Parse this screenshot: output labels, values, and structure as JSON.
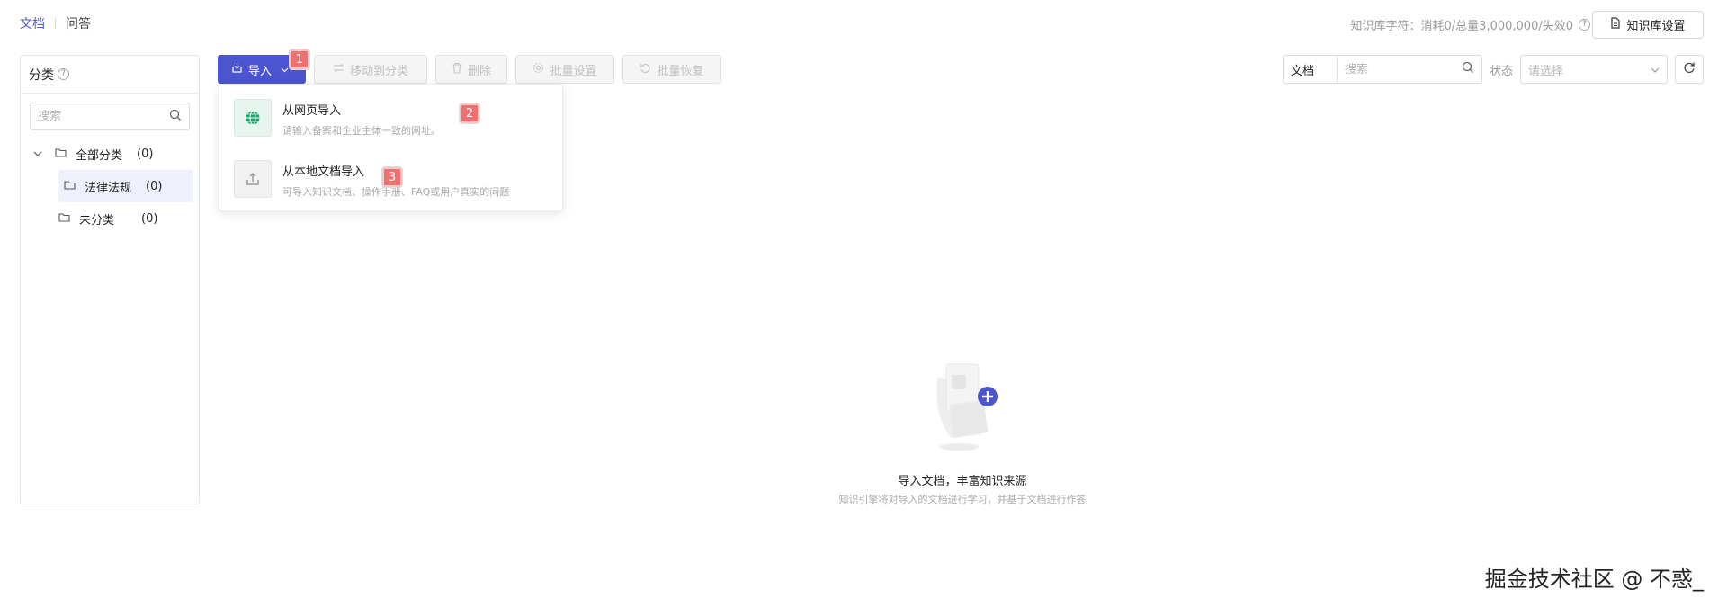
{
  "top_tabs": {
    "docs": "文档",
    "qa": "问答"
  },
  "quota": {
    "text": "知识库字符：消耗0/总量3,000,000/失效0",
    "help": "?"
  },
  "kb_settings_label": "知识库设置",
  "sidebar": {
    "title": "分类",
    "search_placeholder": "搜索",
    "tree": [
      {
        "label": "全部分类",
        "count": "(0)"
      },
      {
        "label": "法律法规",
        "count": "(0)"
      },
      {
        "label": "未分类",
        "count": "(0)"
      }
    ]
  },
  "toolbar": {
    "import": "导入",
    "move": "移动到分类",
    "delete": "删除",
    "batch_settings": "批量设置",
    "batch_restore": "批量恢复"
  },
  "badges": [
    "1",
    "2",
    "3"
  ],
  "import_menu": {
    "web": {
      "title": "从网页导入",
      "desc": "请输入备案和企业主体一致的网址。"
    },
    "local": {
      "title": "从本地文档导入",
      "desc": "可导入知识文档、操作手册、FAQ或用户真实的问题"
    }
  },
  "filters": {
    "type": "文档",
    "search_placeholder": "搜索",
    "status_label": "状态",
    "status_placeholder": "请选择"
  },
  "empty_state": {
    "title": "导入文档，丰富知识来源",
    "desc": "知识引擎将对导入的文档进行学习，并基于文档进行作答"
  },
  "watermark": "掘金技术社区 @ 不惑_",
  "colors": {
    "primary": "#4a55cf",
    "badge": "#f07070",
    "selected_bg": "#eef1fb"
  }
}
